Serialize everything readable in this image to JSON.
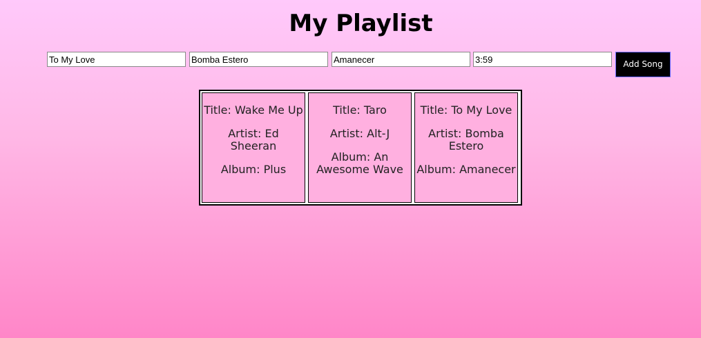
{
  "page": {
    "title": "My Playlist"
  },
  "form": {
    "title_value": "To My Love",
    "artist_value": "Bomba Estero",
    "album_value": "Amanecer",
    "length_value": "3:59",
    "add_button_label": "Add Song"
  },
  "songs": [
    {
      "title": "Title: Wake Me Up",
      "artist": "Artist: Ed Sheeran",
      "album": "Album: Plus"
    },
    {
      "title": "Title: Taro",
      "artist": "Artist: Alt-J",
      "album": "Album: An Awesome Wave"
    },
    {
      "title": "Title: To My Love",
      "artist": "Artist: Bomba Estero",
      "album": "Album: Amanecer"
    }
  ],
  "colors": {
    "background_top": "#ffc9fb",
    "background_bottom": "#ff86c8",
    "card_background": "#ffb0e0",
    "button_background": "#000000",
    "button_border": "#6a6aff"
  }
}
